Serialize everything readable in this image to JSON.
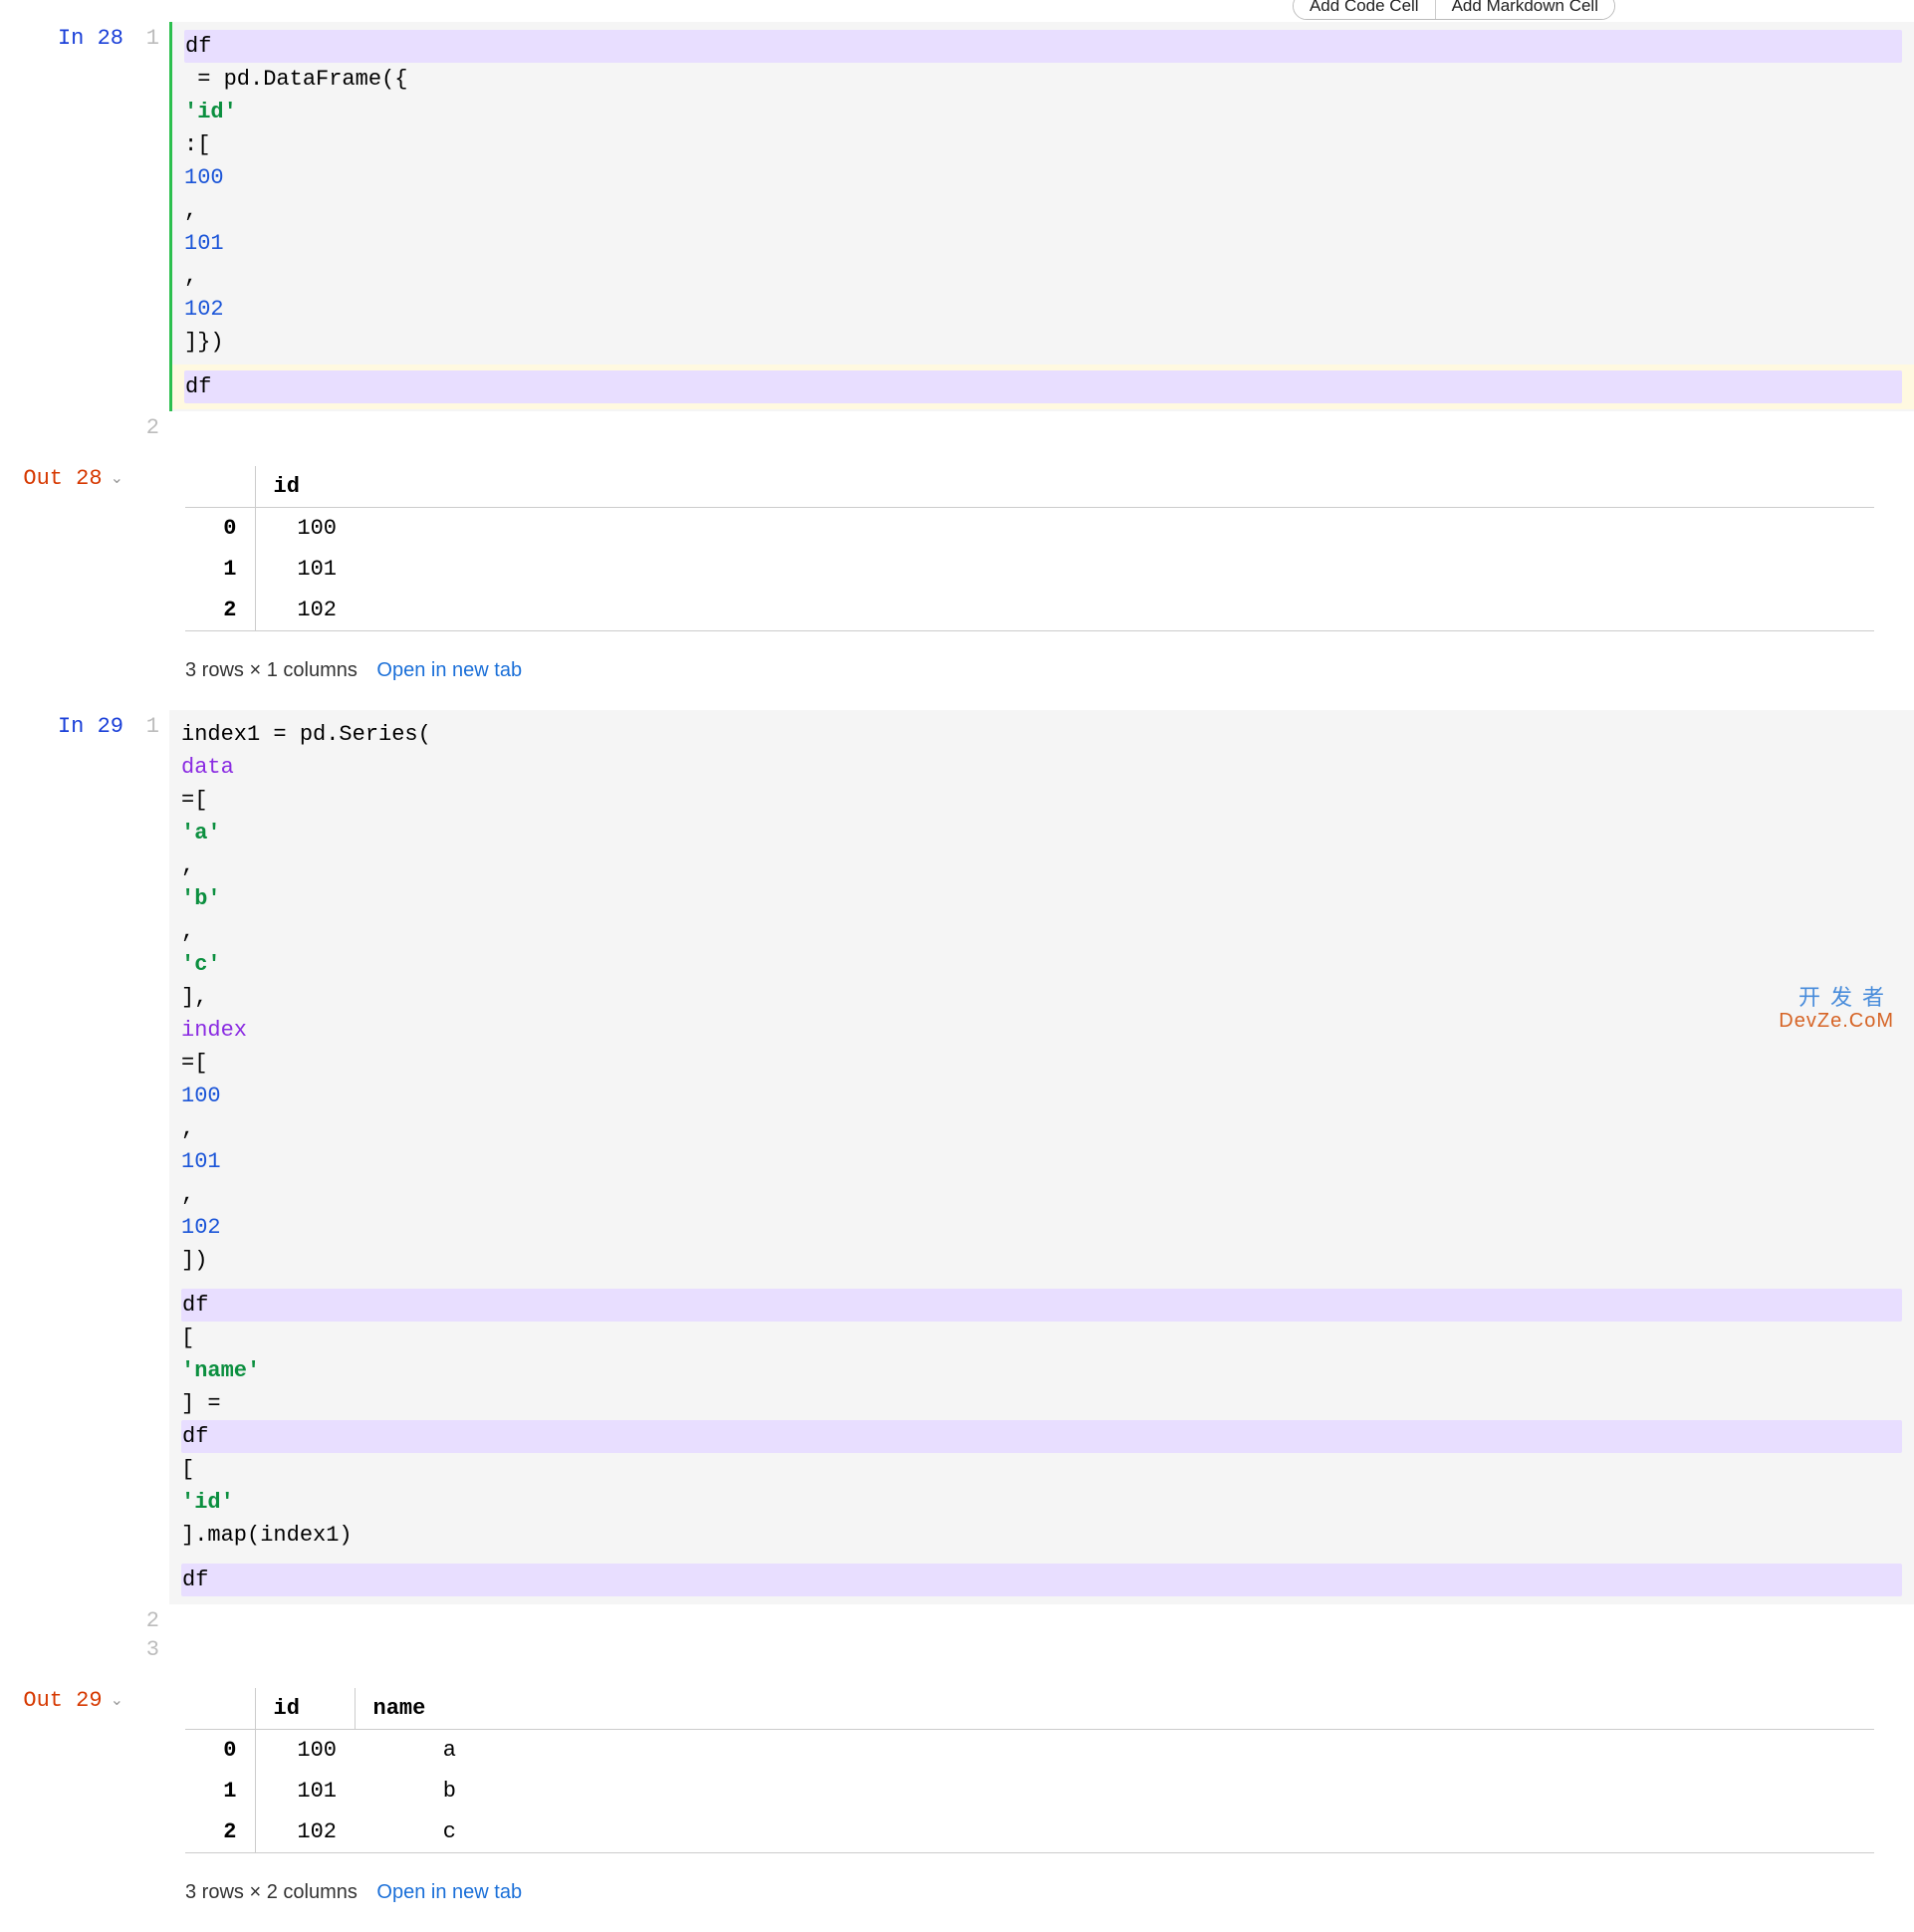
{
  "toolbar": {
    "add_code_label": "Add Code Cell",
    "add_md_label": "Add Markdown Cell"
  },
  "cells": {
    "c28": {
      "in_label": "In 28",
      "out_label": "Out 28",
      "line1_num": "1",
      "line2_num": "2",
      "code": {
        "l1": {
          "p1": "df",
          "p2": " = pd.DataFrame({",
          "p3": "'id'",
          "p4": ":[",
          "n1": "100",
          "c1": ", ",
          "n2": "101",
          "c2": ", ",
          "n3": "102",
          "p5": "]})"
        },
        "l2": {
          "p1": "df"
        }
      },
      "table": {
        "blank": "",
        "cols": {
          "c0": "id"
        },
        "rows": {
          "r0": {
            "idx": "0",
            "v0": "100"
          },
          "r1": {
            "idx": "1",
            "v0": "101"
          },
          "r2": {
            "idx": "2",
            "v0": "102"
          }
        }
      },
      "footer": {
        "shape": "3 rows × 1 columns",
        "link": "Open in new tab"
      }
    },
    "c29": {
      "in_label": "In 29",
      "out_label": "Out 29",
      "line1_num": "1",
      "line2_num": "2",
      "line3_num": "3",
      "code": {
        "l1": {
          "p1": "index1 = pd.Series(",
          "kw1": "data",
          "p2": "=[",
          "s1": "'a'",
          "c1": ", ",
          "s2": "'b'",
          "c2": ", ",
          "s3": "'c'",
          "p3": "], ",
          "kw2": "index",
          "p4": "=[",
          "n1": "100",
          "c3": ", ",
          "n2": "101",
          "c4": ", ",
          "n3": "102",
          "p5": "])"
        },
        "l2": {
          "p1": "df",
          "p2": "[",
          "s1": "'name'",
          "p3": "] = ",
          "p4": "df",
          "p5": "[",
          "s2": "'id'",
          "p6": "].map(index1)"
        },
        "l3": {
          "p1": "df"
        }
      },
      "table": {
        "blank": "",
        "cols": {
          "c0": "id",
          "c1": "name"
        },
        "rows": {
          "r0": {
            "idx": "0",
            "v0": "100",
            "v1": "a"
          },
          "r1": {
            "idx": "1",
            "v0": "101",
            "v1": "b"
          },
          "r2": {
            "idx": "2",
            "v0": "102",
            "v1": "c"
          }
        }
      },
      "footer": {
        "shape": "3 rows × 2 columns",
        "link": "Open in new tab"
      }
    }
  },
  "watermark": {
    "cn": "开发者",
    "en": "DevZe.CoM"
  }
}
